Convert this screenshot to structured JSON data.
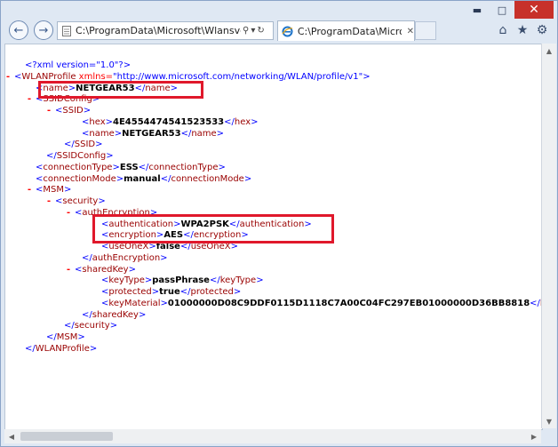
{
  "window": {
    "minimize_icon": "minimize-icon",
    "maximize_icon": "maximize-icon",
    "close_glyph": "✕"
  },
  "nav": {
    "address": "C:\\ProgramData\\Microsoft\\Wlansvc\\Profiles",
    "tab_title": "C:\\ProgramData\\Microsoft...",
    "tab_close": "✕",
    "search_glyph": "⚲",
    "dropdown_glyph": "▾",
    "refresh_glyph": "↻"
  },
  "xml_lines": [
    {
      "m": "",
      "text_pi": "<?xml version=\"1.0\"?>"
    },
    {
      "m": "-",
      "open": "WLANProfile",
      "attr": " xmlns=",
      "aval": "\"http://www.microsoft.com/networking/WLAN/profile/v1\""
    },
    {
      "m": "",
      "tag": "name",
      "val": "NETGEAR53"
    },
    {
      "m": "-",
      "open": "SSIDConfig"
    },
    {
      "m": "-",
      "open": "SSID"
    },
    {
      "m": "",
      "tag": "hex",
      "val": "4E4554474541523533"
    },
    {
      "m": "",
      "tag": "name",
      "val": "NETGEAR53"
    },
    {
      "m": "",
      "close": "SSID"
    },
    {
      "m": "",
      "close": "SSIDConfig"
    },
    {
      "m": "",
      "tag": "connectionType",
      "val": "ESS"
    },
    {
      "m": "",
      "tag": "connectionMode",
      "val": "manual"
    },
    {
      "m": "-",
      "open": "MSM"
    },
    {
      "m": "-",
      "open": "security"
    },
    {
      "m": "-",
      "open": "authEncryption"
    },
    {
      "m": "",
      "tag": "authentication",
      "val": "WPA2PSK"
    },
    {
      "m": "",
      "tag": "encryption",
      "val": "AES"
    },
    {
      "m": "",
      "tag": "useOneX",
      "val": "false"
    },
    {
      "m": "",
      "close": "authEncryption"
    },
    {
      "m": "-",
      "open": "sharedKey"
    },
    {
      "m": "",
      "tag": "keyType",
      "val": "passPhrase"
    },
    {
      "m": "",
      "tag": "protected",
      "val": "true"
    },
    {
      "m": "",
      "tag": "keyMaterial",
      "val": "01000000D08C9DDF0115D1118C7A00C04FC297EB01000000D36BB8818"
    },
    {
      "m": "",
      "close": "sharedKey"
    },
    {
      "m": "",
      "close": "security"
    },
    {
      "m": "",
      "close": "MSM"
    },
    {
      "m": "",
      "close": "WLANProfile"
    }
  ]
}
